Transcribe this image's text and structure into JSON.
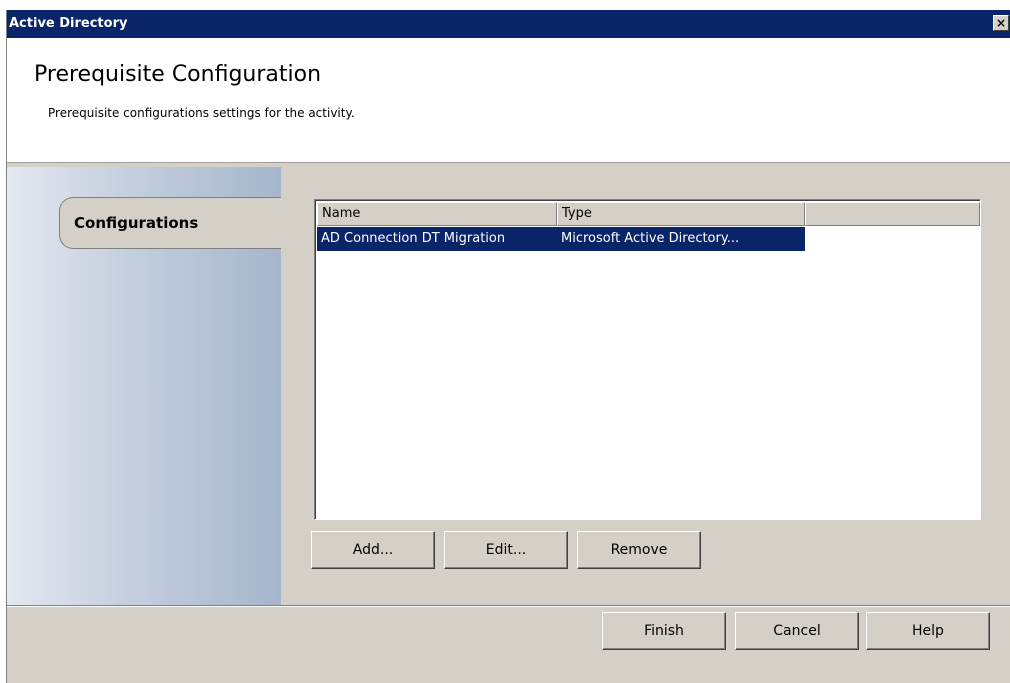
{
  "window": {
    "title": "Active Directory",
    "close_glyph": "×"
  },
  "header": {
    "title": "Prerequisite Configuration",
    "subtitle": "Prerequisite configurations settings for the activity."
  },
  "sidebar": {
    "tab_label": "Configurations"
  },
  "list": {
    "columns": [
      "Name",
      "Type"
    ],
    "rows": [
      {
        "name": "AD Connection DT Migration",
        "type": "Microsoft Active Directory...",
        "selected": true
      }
    ]
  },
  "list_buttons": {
    "add": "Add...",
    "edit": "Edit...",
    "remove": "Remove"
  },
  "footer_buttons": {
    "finish": "Finish",
    "cancel": "Cancel",
    "help": "Help"
  },
  "colors": {
    "title_bar": "#0a246a",
    "dialog_face": "#d4d0c8",
    "selection": "#0a246a"
  }
}
